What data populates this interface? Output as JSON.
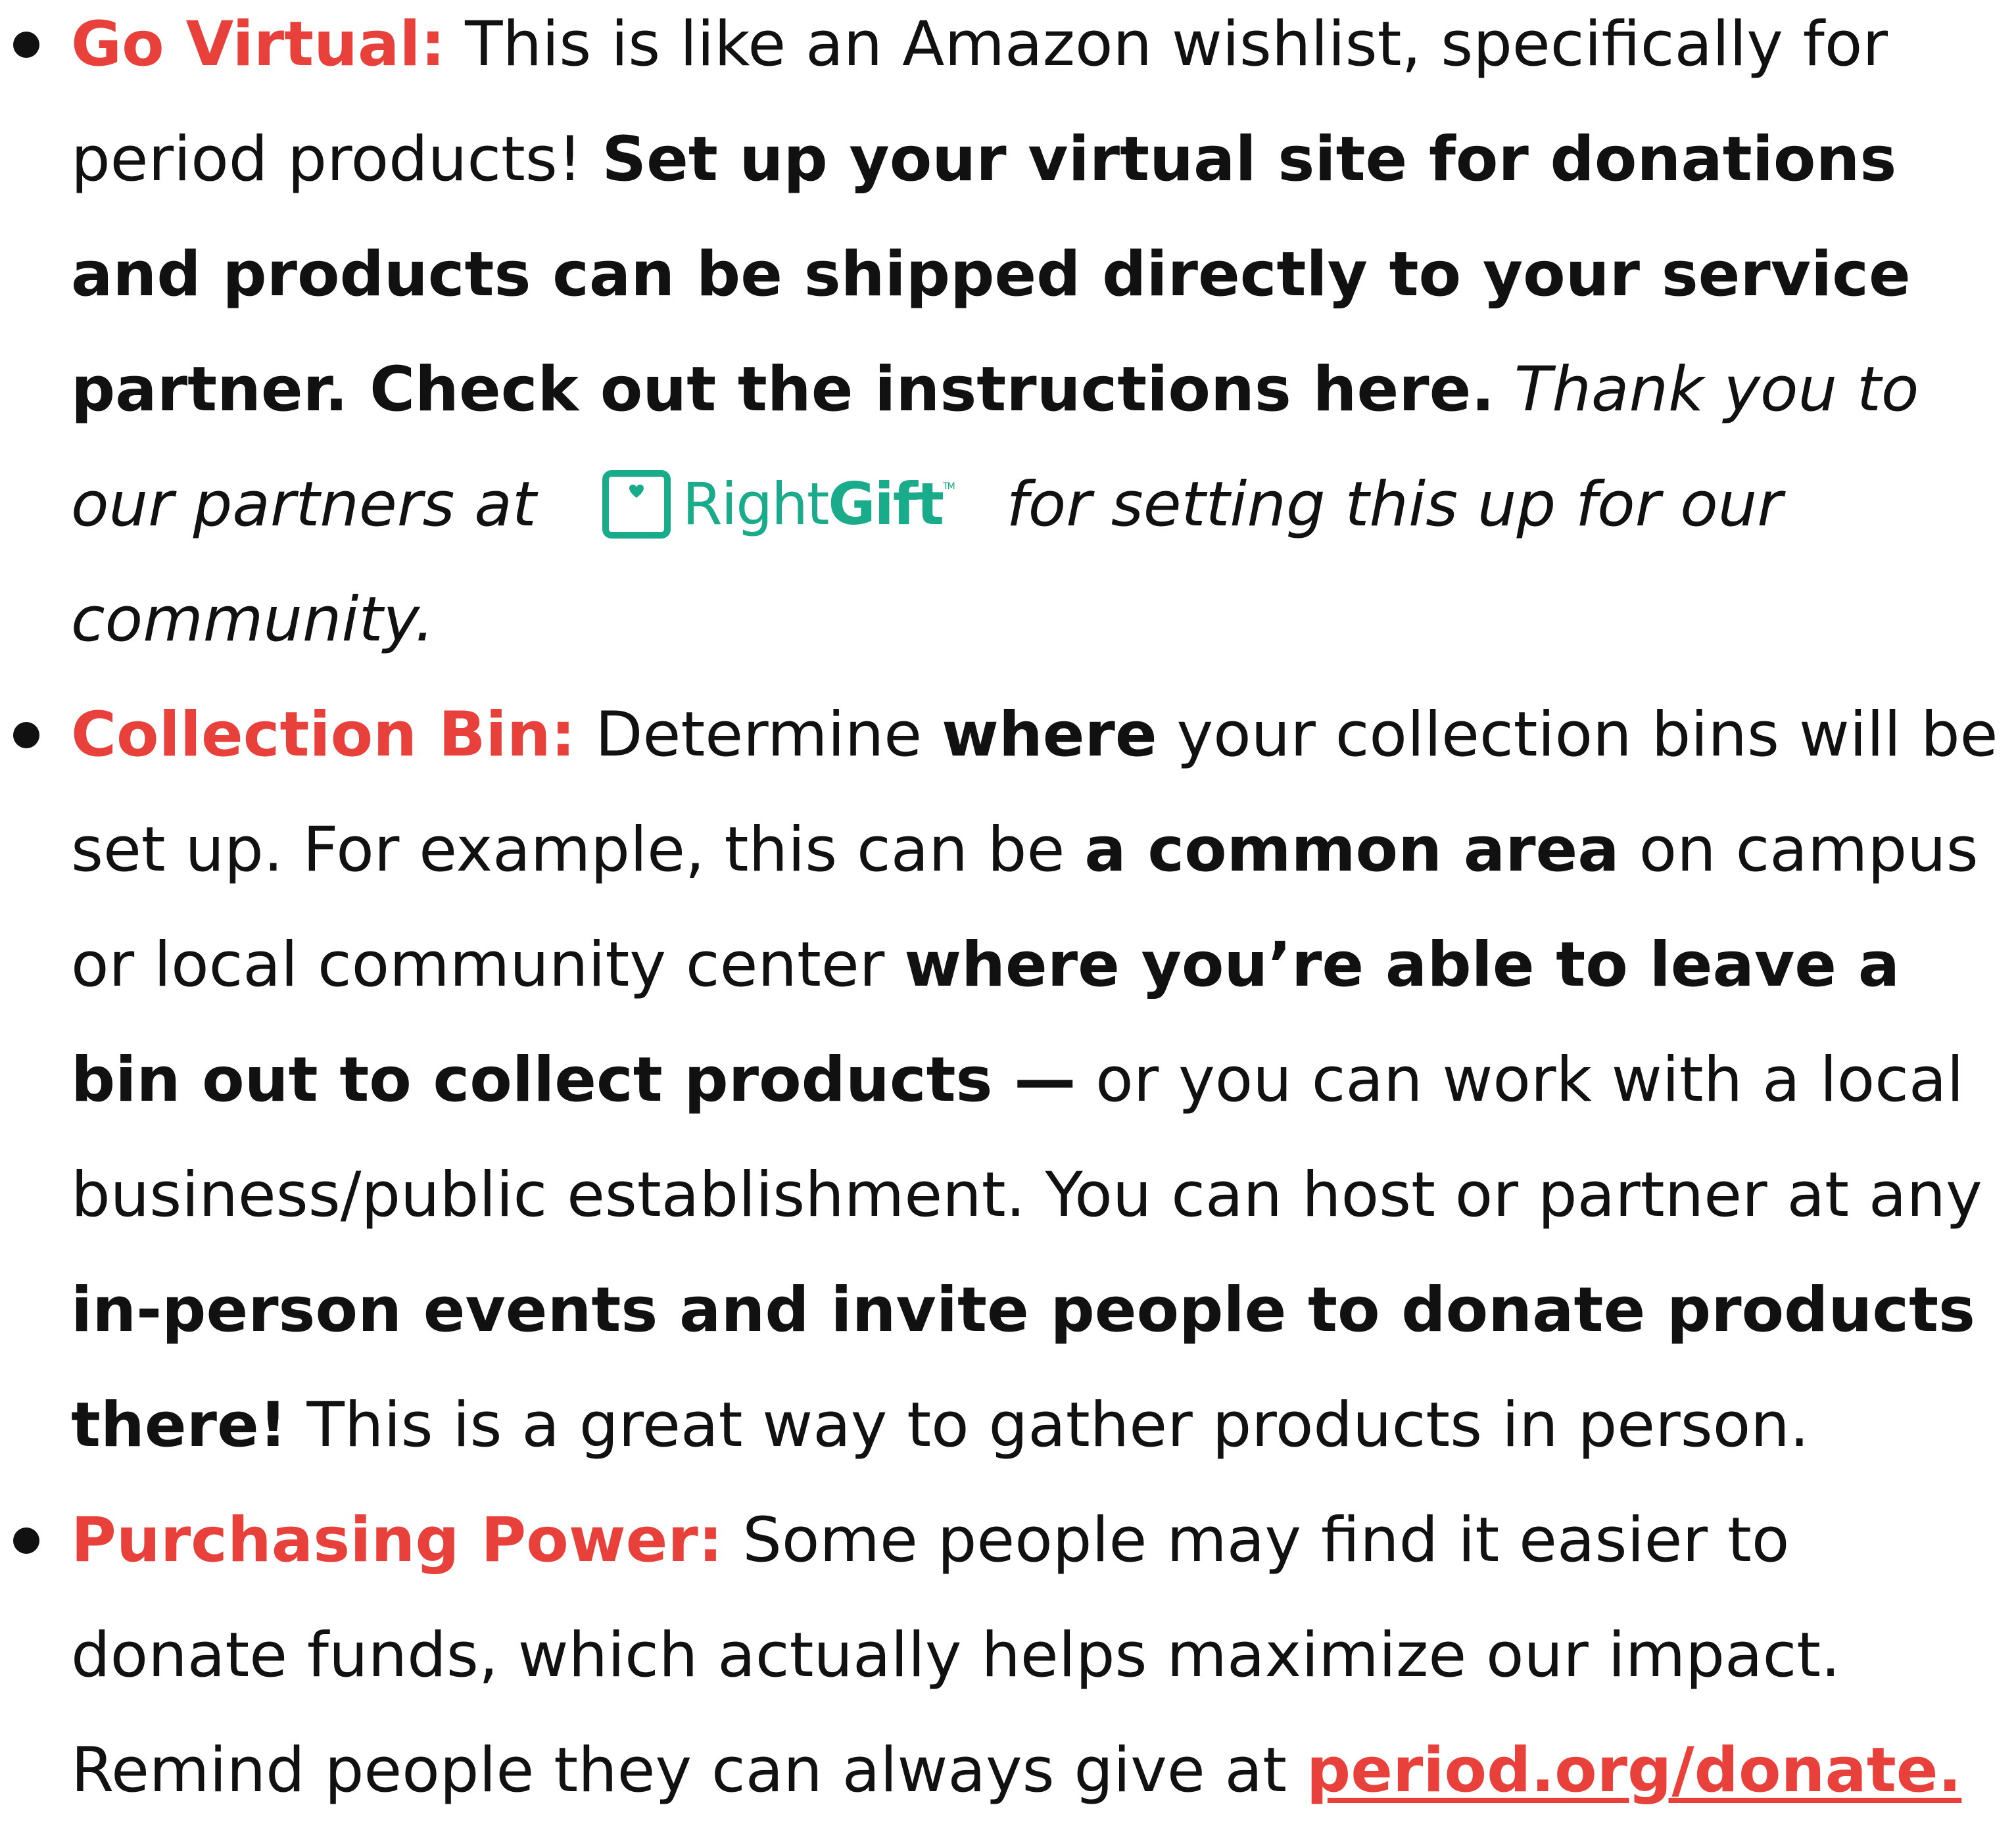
{
  "items": [
    {
      "heading": "Go Virtual:",
      "text1": " This is like an Amazon wishlist, specifically for period products! ",
      "bold1": "Set up your virtual site for donations and products can be shipped directly to your service partner. Check out the instructions here.",
      "italic1": "  Thank you to our partners at ",
      "logo_brand_right": "Right",
      "logo_brand_gift": "Gift",
      "logo_tm": "TM",
      "italic2": " for setting this up for our community."
    },
    {
      "heading": "Collection Bin:",
      "text1": " Determine ",
      "bold1": "where",
      "text2": " your collection bins will be set up. For example, this can be ",
      "bold2": "a common area",
      "text3": " on campus or local community center ",
      "bold3": "where you’re able to leave a bin out to collect products —",
      "text4": " or you can work with a local business/public establishment. You can host or partner at any ",
      "bold4": "in-person events and invite people to donate products there!",
      "text5": " This is a great way to gather products in person."
    },
    {
      "heading": "Purchasing Power:",
      "text1": " Some people may find it easier to donate funds, which actually helps maximize our impact. Remind people they can always give at ",
      "link": "period.org/donate."
    }
  ],
  "colors": {
    "heading": "#e8403b",
    "logo": "#1aab8a",
    "text": "#111111"
  },
  "icons": {
    "logo_mark": "heart-in-box-icon"
  }
}
